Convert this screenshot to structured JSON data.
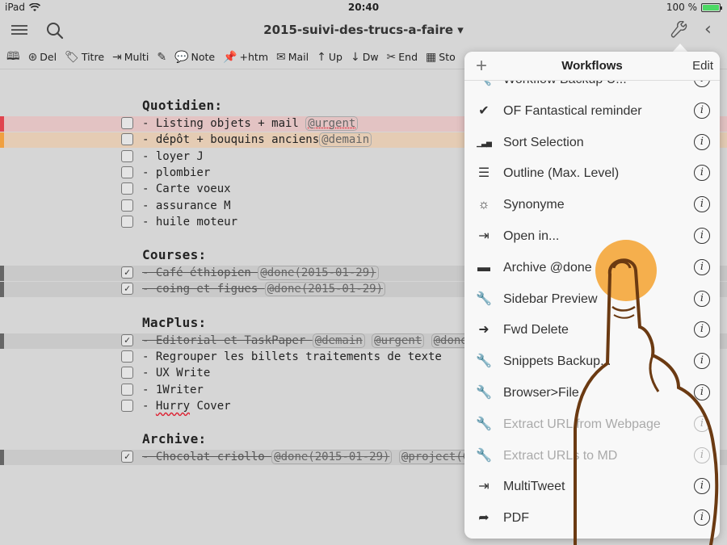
{
  "status": {
    "device": "iPad",
    "time": "20:40",
    "battery": "100 %",
    "battery_level": 1.0
  },
  "nav": {
    "title": "2015-suivi-des-trucs-a-faire ▾"
  },
  "toolbar": [
    {
      "icon": "book-icon",
      "label": ""
    },
    {
      "icon": "forward-delete-icon",
      "label": "Del"
    },
    {
      "icon": "tag-icon",
      "label": "Titre"
    },
    {
      "icon": "export-icon",
      "label": "Multi"
    },
    {
      "icon": "edit-icon",
      "label": ""
    },
    {
      "icon": "speech-icon",
      "label": "Note"
    },
    {
      "icon": "pin-icon",
      "label": "+htm"
    },
    {
      "icon": "mail-icon",
      "label": "Mail"
    },
    {
      "icon": "arrow-up-icon",
      "label": "Up"
    },
    {
      "icon": "arrow-down-icon",
      "label": "Dw"
    },
    {
      "icon": "scissors-icon",
      "label": "End"
    },
    {
      "icon": "register-icon",
      "label": "Sto"
    }
  ],
  "doc": {
    "sections": [
      {
        "heading": "Quotidien:",
        "items": [
          {
            "text": "- Listing objets + mail ",
            "tags": [
              "@urgent"
            ],
            "done": false,
            "bar": "#e0444e",
            "highlight": "#e3c3c3"
          },
          {
            "text": "- dépôt + bouquins anciens",
            "tags": [
              "@demain"
            ],
            "done": false,
            "bar": "#f0a040",
            "highlight": "#e5ccb4"
          },
          {
            "text": "- loyer J",
            "tags": [],
            "done": false
          },
          {
            "text": "- plombier",
            "tags": [],
            "done": false
          },
          {
            "text": "- Carte voeux",
            "tags": [],
            "done": false
          },
          {
            "text": "- assurance M",
            "tags": [],
            "done": false
          },
          {
            "text": "- huile moteur",
            "tags": [],
            "done": false
          }
        ]
      },
      {
        "heading": "Courses:",
        "items": [
          {
            "text": "- Café éthiopien ",
            "tags": [
              "@done(2015-01-29)"
            ],
            "done": true,
            "bar": "#666666",
            "highlight": "#c9c9c9"
          },
          {
            "text": "- coing et figues ",
            "tags": [
              "@done(2015-01-29)"
            ],
            "done": true,
            "bar": "#666666",
            "highlight": "#c9c9c9"
          }
        ]
      },
      {
        "heading": "MacPlus:",
        "items": [
          {
            "text": "- Editorial et TaskPaper ",
            "tags": [
              "@demain",
              "@urgent",
              "@done("
            ],
            "done": true,
            "bar": "#666666",
            "highlight": "#c9c9c9"
          },
          {
            "text": "- Regrouper les billets traitements de texte",
            "tags": [],
            "done": false
          },
          {
            "text": "- UX Write",
            "tags": [],
            "done": false
          },
          {
            "text": "- 1Writer",
            "tags": [],
            "done": false
          },
          {
            "text": "- Hurry Cover",
            "tags": [],
            "done": false
          }
        ]
      },
      {
        "heading": "Archive:",
        "items": [
          {
            "text": "- Chocolat criollo ",
            "tags": [
              "@done(2015-01-29)",
              "@project(Co"
            ],
            "done": true,
            "bar": "#666666",
            "highlight": "#c9c9c9"
          }
        ]
      }
    ]
  },
  "workflows": {
    "title": "Workflows",
    "add_label": "+",
    "edit_label": "Edit",
    "items": [
      {
        "label": "Workflow Backup U...",
        "icon": "wrench-icon",
        "dim": false
      },
      {
        "label": "OF Fantastical reminder",
        "icon": "checkmark-icon",
        "dim": false
      },
      {
        "label": "Sort Selection",
        "icon": "sort-icon",
        "dim": false
      },
      {
        "label": "Outline (Max. Level)",
        "icon": "list-icon",
        "dim": false
      },
      {
        "label": "Synonyme",
        "icon": "lightbulb-icon",
        "dim": false
      },
      {
        "label": "Open in...",
        "icon": "open-in-icon",
        "dim": false
      },
      {
        "label": "Archive @done",
        "icon": "archive-icon",
        "dim": false
      },
      {
        "label": "Sidebar Preview",
        "icon": "wrench-icon",
        "dim": false
      },
      {
        "label": "Fwd Delete",
        "icon": "forward-delete-icon",
        "dim": false
      },
      {
        "label": "Snippets Backup...",
        "icon": "wrench-icon",
        "dim": false
      },
      {
        "label": "Browser>File",
        "icon": "wrench-icon",
        "dim": false
      },
      {
        "label": "Extract URL from Webpage",
        "icon": "wrench-icon",
        "dim": true
      },
      {
        "label": "Extract URLs to MD",
        "icon": "wrench-icon",
        "dim": true
      },
      {
        "label": "MultiTweet",
        "icon": "export-icon",
        "dim": false
      },
      {
        "label": "PDF",
        "icon": "share-arrow-icon",
        "dim": false
      }
    ]
  },
  "colors": {
    "touch": "#f4a63a",
    "hand_outline": "#6b3a12"
  }
}
